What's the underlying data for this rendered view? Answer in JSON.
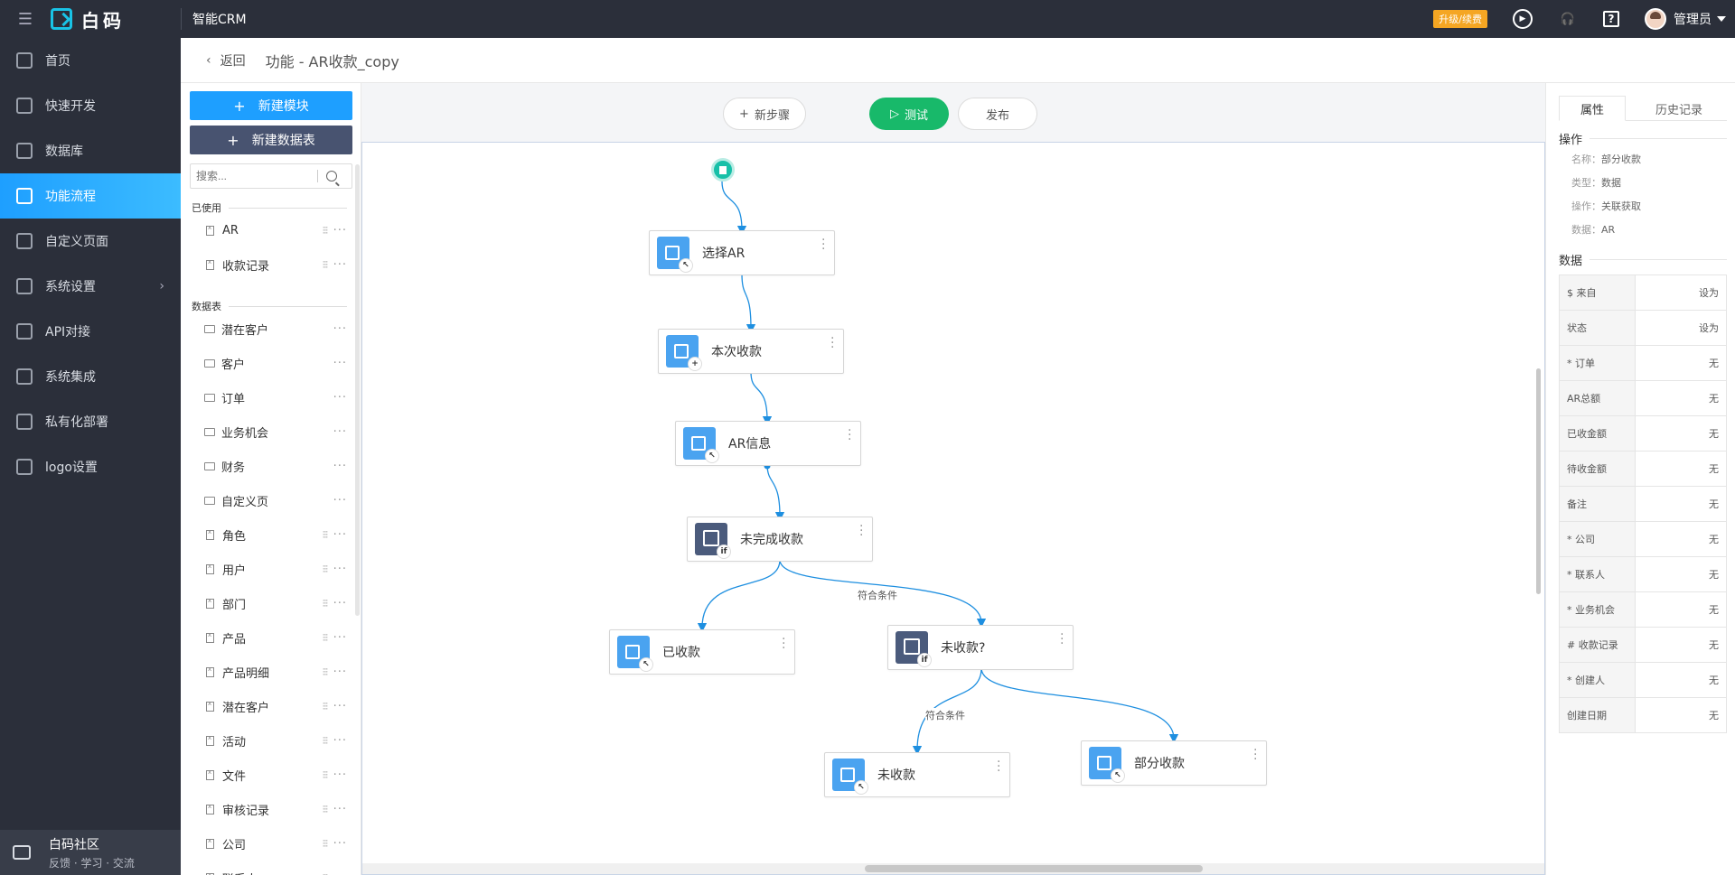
{
  "topbar": {
    "brand": "白码",
    "app_name": "智能CRM",
    "upgrade_badge": "升级/续费",
    "user_name": "管理员",
    "icons": [
      "menu-toggle-icon",
      "play-icon",
      "headset-icon",
      "help-icon"
    ]
  },
  "sidebar": {
    "items": [
      {
        "label": "首页",
        "icon": "home-icon"
      },
      {
        "label": "快速开发",
        "icon": "cube-icon"
      },
      {
        "label": "数据库",
        "icon": "database-icon"
      },
      {
        "label": "功能流程",
        "icon": "flow-icon"
      },
      {
        "label": "自定义页面",
        "icon": "page-icon"
      },
      {
        "label": "系统设置",
        "icon": "settings-icon"
      },
      {
        "label": "API对接",
        "icon": "api-icon"
      },
      {
        "label": "系统集成",
        "icon": "layers-icon"
      },
      {
        "label": "私有化部署",
        "icon": "lock-icon"
      },
      {
        "label": "logo设置",
        "icon": "logo-icon"
      }
    ],
    "active_index": 3,
    "community_title": "白码社区",
    "community_sub": "反馈 · 学习 · 交流"
  },
  "breadcrumb": {
    "back": "返回",
    "title": "功能 - AR收款_copy"
  },
  "module_panel": {
    "new_module": "新建模块",
    "new_table": "新建数据表",
    "search_placeholder": "搜索...",
    "used_label": "已使用",
    "used_items": [
      "AR",
      "收款记录"
    ],
    "tables_label": "数据表",
    "folders": [
      "潜在客户",
      "客户",
      "订单",
      "业务机会",
      "财务",
      "自定义页"
    ],
    "tables": [
      "角色",
      "用户",
      "部门",
      "产品",
      "产品明细",
      "潜在客户",
      "活动",
      "文件",
      "审核记录",
      "公司",
      "联系人"
    ]
  },
  "canvas": {
    "new_step": "新步骤",
    "test": "测试",
    "publish": "发布",
    "nodes": [
      {
        "label": "选择AR",
        "type": "data",
        "badge": "↖"
      },
      {
        "label": "本次收款",
        "type": "data",
        "badge": "+"
      },
      {
        "label": "AR信息",
        "type": "data",
        "badge": "↖"
      },
      {
        "label": "未完成收款",
        "type": "cond",
        "badge": "if"
      },
      {
        "label": "已收款",
        "type": "data",
        "badge": "↖"
      },
      {
        "label": "未收款?",
        "type": "cond",
        "badge": "if"
      },
      {
        "label": "未收款",
        "type": "data",
        "badge": "↖"
      },
      {
        "label": "部分收款",
        "type": "data",
        "badge": "↖"
      }
    ],
    "condition_labels": [
      "符合条件",
      "符合条件"
    ]
  },
  "properties": {
    "tabs": [
      "属性",
      "历史记录"
    ],
    "section_op": "操作",
    "op_fields": [
      {
        "k": "名称：",
        "v": "部分收款"
      },
      {
        "k": "类型：",
        "v": "数据"
      },
      {
        "k": "操作：",
        "v": "关联获取"
      },
      {
        "k": "数据：",
        "v": "AR"
      }
    ],
    "section_data": "数据",
    "data_rows": [
      {
        "k": "$ 来自",
        "v": "设为"
      },
      {
        "k": "状态",
        "v": "设为"
      },
      {
        "k": "* 订单",
        "v": "无"
      },
      {
        "k": "AR总额",
        "v": "无"
      },
      {
        "k": "已收金额",
        "v": "无"
      },
      {
        "k": "待收金额",
        "v": "无"
      },
      {
        "k": "备注",
        "v": "无"
      },
      {
        "k": "* 公司",
        "v": "无"
      },
      {
        "k": "* 联系人",
        "v": "无"
      },
      {
        "k": "* 业务机会",
        "v": "无"
      },
      {
        "k": "# 收款记录",
        "v": "无"
      },
      {
        "k": "* 创建人",
        "v": "无"
      },
      {
        "k": "创建日期",
        "v": "无"
      }
    ]
  }
}
